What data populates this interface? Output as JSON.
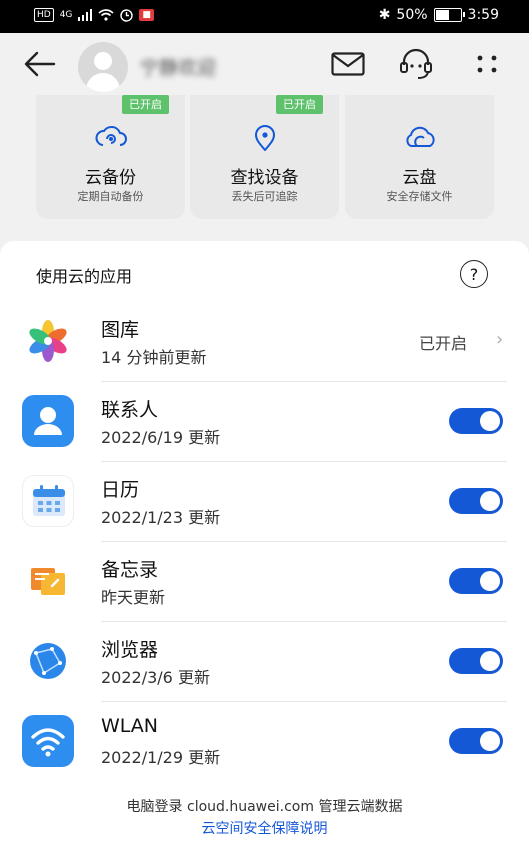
{
  "status_bar": {
    "hd": "HD",
    "network": "4G",
    "battery": "50%",
    "time": "3:59"
  },
  "header": {
    "user_name": "宁静欢迎",
    "icons": [
      "back-arrow-icon",
      "mail-icon",
      "customer-service-icon",
      "more-icon"
    ]
  },
  "services": [
    {
      "title": "云备份",
      "subtitle": "定期自动备份",
      "badge": "已开启",
      "icon": "cloud-backup-icon"
    },
    {
      "title": "查找设备",
      "subtitle": "丢失后可追踪",
      "badge": "已开启",
      "icon": "location-pin-icon"
    },
    {
      "title": "云盘",
      "subtitle": "安全存储文件",
      "badge": "",
      "icon": "cloud-drive-icon"
    }
  ],
  "apps_section": {
    "title": "使用云的应用",
    "help_icon": "question-icon",
    "items": [
      {
        "name": "图库",
        "meta": "14 分钟前更新",
        "status": "已开启",
        "icon": "gallery-icon"
      },
      {
        "name": "联系人",
        "meta": "2022/6/19 更新",
        "toggle": true,
        "icon": "contacts-icon"
      },
      {
        "name": "日历",
        "meta": "2022/1/23 更新",
        "toggle": true,
        "icon": "calendar-icon"
      },
      {
        "name": "备忘录",
        "meta": "昨天更新",
        "toggle": true,
        "icon": "notes-icon"
      },
      {
        "name": "浏览器",
        "meta": "2022/3/6 更新",
        "toggle": true,
        "icon": "browser-icon"
      },
      {
        "name": "WLAN",
        "meta": "2022/1/29 更新",
        "toggle": true,
        "icon": "wifi-icon"
      }
    ]
  },
  "footer": {
    "line1": "电脑登录 cloud.huawei.com 管理云端数据",
    "link": "云空间安全保障说明"
  },
  "colors": {
    "accent": "#1558d6",
    "badge_green": "#5dc26b",
    "background": "#f1f1f1"
  }
}
